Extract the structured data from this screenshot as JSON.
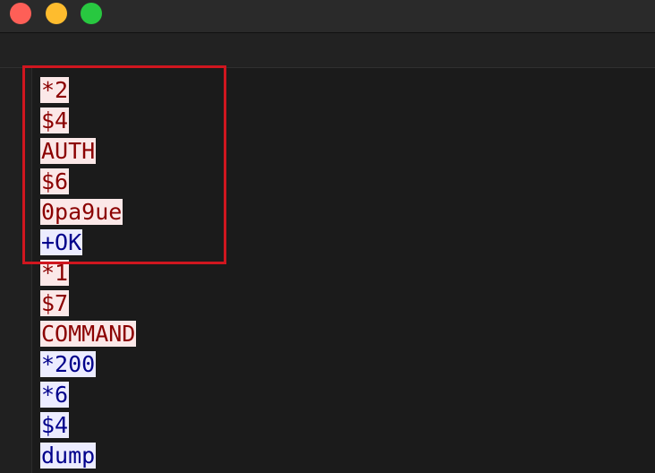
{
  "colors": {
    "client_text": "#8b0000",
    "client_background": "#fbe8e8",
    "server_text": "#00008b",
    "server_background": "#ececff",
    "annotation_border": "#d0161f"
  },
  "window": {
    "buttons": [
      "close",
      "minimize",
      "zoom"
    ]
  },
  "stream": [
    {
      "text": "*2",
      "direction": "client"
    },
    {
      "text": "$4",
      "direction": "client"
    },
    {
      "text": "AUTH",
      "direction": "client"
    },
    {
      "text": "$6",
      "direction": "client"
    },
    {
      "text": "0pa9ue",
      "direction": "client"
    },
    {
      "text": "+OK",
      "direction": "server"
    },
    {
      "text": "*1",
      "direction": "client"
    },
    {
      "text": "$7",
      "direction": "client"
    },
    {
      "text": "COMMAND",
      "direction": "client"
    },
    {
      "text": "*200",
      "direction": "server"
    },
    {
      "text": "*6",
      "direction": "server"
    },
    {
      "text": "$4",
      "direction": "server"
    },
    {
      "text": "dump",
      "direction": "server"
    }
  ]
}
